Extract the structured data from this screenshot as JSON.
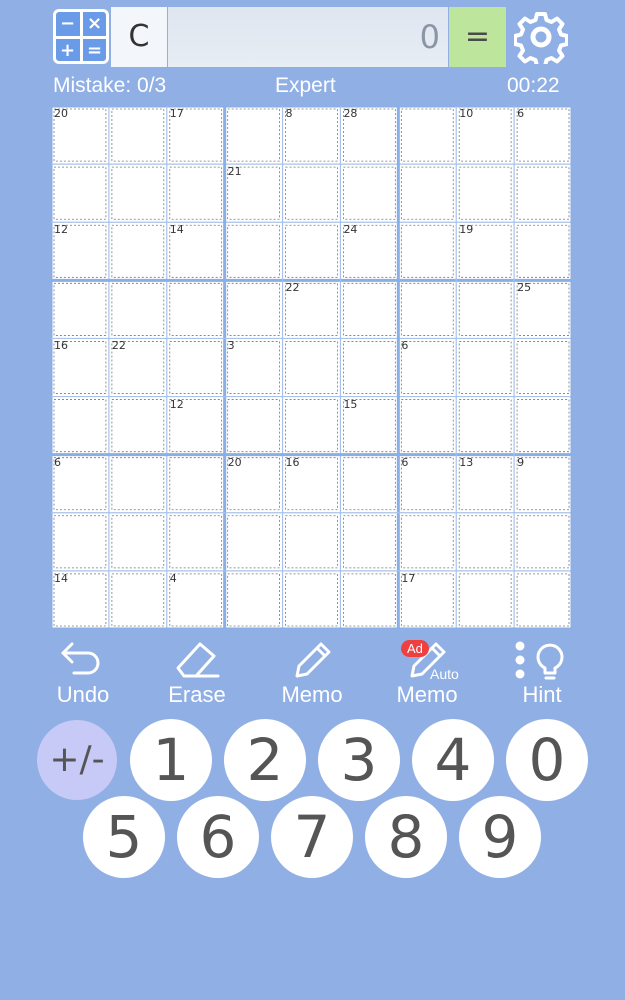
{
  "toolbar": {
    "clear_label": "C",
    "display_value": "0",
    "equals_label": "=",
    "calc_symbols": {
      "minus": "−",
      "times": "×",
      "plus": "+",
      "equals": "="
    }
  },
  "status": {
    "mistakes": "Mistake: 0/3",
    "difficulty": "Expert",
    "timer": "00:22"
  },
  "board": {
    "clues": [
      {
        "row": 0,
        "col": 0,
        "sum": "20"
      },
      {
        "row": 0,
        "col": 2,
        "sum": "17"
      },
      {
        "row": 0,
        "col": 4,
        "sum": "8"
      },
      {
        "row": 0,
        "col": 5,
        "sum": "28"
      },
      {
        "row": 0,
        "col": 7,
        "sum": "10"
      },
      {
        "row": 0,
        "col": 8,
        "sum": "6"
      },
      {
        "row": 1,
        "col": 3,
        "sum": "21"
      },
      {
        "row": 2,
        "col": 0,
        "sum": "12"
      },
      {
        "row": 2,
        "col": 2,
        "sum": "14"
      },
      {
        "row": 2,
        "col": 5,
        "sum": "24"
      },
      {
        "row": 2,
        "col": 7,
        "sum": "19"
      },
      {
        "row": 3,
        "col": 4,
        "sum": "22"
      },
      {
        "row": 3,
        "col": 8,
        "sum": "25"
      },
      {
        "row": 4,
        "col": 0,
        "sum": "16"
      },
      {
        "row": 4,
        "col": 1,
        "sum": "22"
      },
      {
        "row": 4,
        "col": 3,
        "sum": "3"
      },
      {
        "row": 4,
        "col": 6,
        "sum": "6"
      },
      {
        "row": 5,
        "col": 2,
        "sum": "12"
      },
      {
        "row": 5,
        "col": 5,
        "sum": "15"
      },
      {
        "row": 6,
        "col": 0,
        "sum": "6"
      },
      {
        "row": 6,
        "col": 3,
        "sum": "20"
      },
      {
        "row": 6,
        "col": 4,
        "sum": "16"
      },
      {
        "row": 6,
        "col": 6,
        "sum": "6"
      },
      {
        "row": 6,
        "col": 7,
        "sum": "13"
      },
      {
        "row": 6,
        "col": 8,
        "sum": "9"
      },
      {
        "row": 8,
        "col": 0,
        "sum": "14"
      },
      {
        "row": 8,
        "col": 2,
        "sum": "4"
      },
      {
        "row": 8,
        "col": 6,
        "sum": "17"
      }
    ]
  },
  "tools": {
    "undo": "Undo",
    "erase": "Erase",
    "memo": "Memo",
    "auto_memo": "Memo",
    "auto_label": "Auto",
    "ad_badge": "Ad",
    "hint": "Hint"
  },
  "numpad": {
    "sign_toggle": "+/-",
    "row1": [
      "1",
      "2",
      "3",
      "4",
      "0"
    ],
    "row2": [
      "5",
      "6",
      "7",
      "8",
      "9"
    ]
  },
  "colors": {
    "background": "#90afe4",
    "grid_line": "#a9c2ea",
    "box_line": "#8aaee6",
    "equals_bg": "#bde59b",
    "sign_bg": "#c7c9f7",
    "ad_badge": "#ee4040"
  }
}
